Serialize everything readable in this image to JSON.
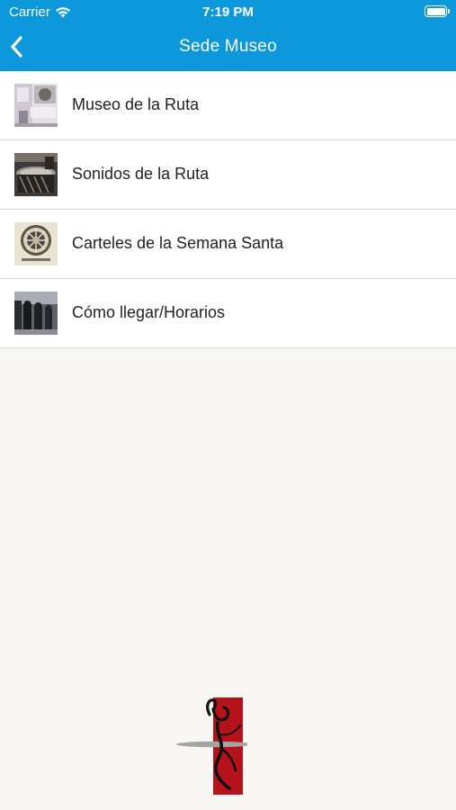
{
  "status_bar": {
    "carrier": "Carrier",
    "time": "7:19 PM",
    "wifi_icon": "wifi-icon",
    "battery_icon": "battery-icon"
  },
  "nav": {
    "title": "Sede Museo",
    "back_icon": "chevron-left-icon"
  },
  "colors": {
    "header": "#0d98dc",
    "background": "#f8f6f2",
    "logo_red": "#b5121b"
  },
  "menu": {
    "items": [
      {
        "label": "Museo de la Ruta",
        "thumbnail": "museum-photo"
      },
      {
        "label": "Sonidos de la Ruta",
        "thumbnail": "drums-photo"
      },
      {
        "label": "Carteles de la Semana Santa",
        "thumbnail": "poster-photo"
      },
      {
        "label": "Cómo llegar/Horarios",
        "thumbnail": "procession-photo"
      }
    ]
  },
  "logo": {
    "icon": "drummer-logo-icon"
  }
}
